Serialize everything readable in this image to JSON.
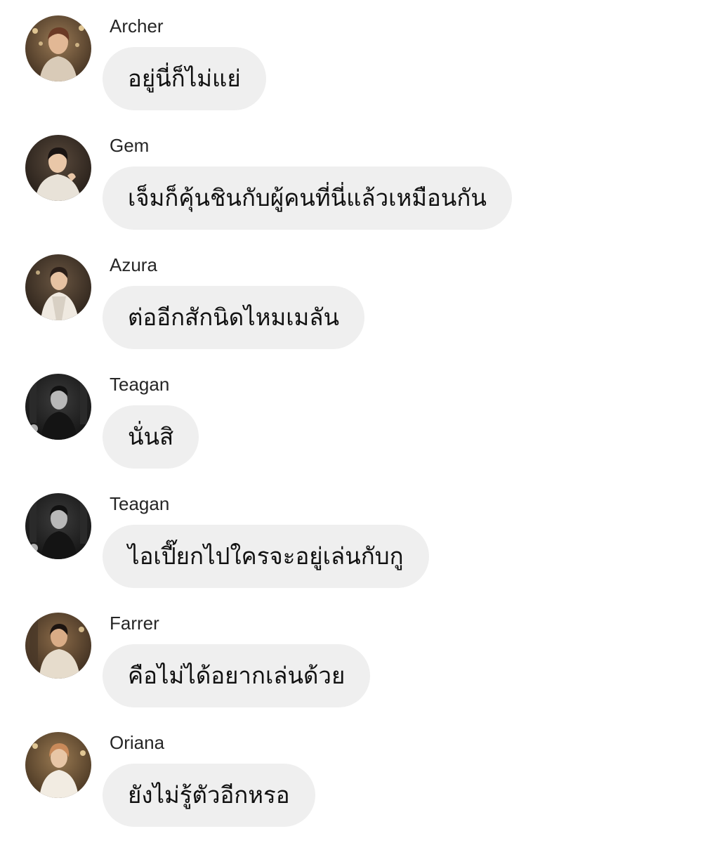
{
  "colors": {
    "background": "#ffffff",
    "bubble": "#efefef",
    "text": "#111111",
    "sender": "#262626"
  },
  "messages": [
    {
      "sender": "Archer",
      "text": "อยู่นี่ก็ไม่แย่",
      "avatar_icon": "avatar-photo-icon"
    },
    {
      "sender": "Gem",
      "text": "เจ็มก็คุ้นชินกับผู้คนที่นี่แล้วเหมือนกัน",
      "avatar_icon": "avatar-photo-icon"
    },
    {
      "sender": "Azura",
      "text": "ต่ออีกสักนิดไหมเมลัน",
      "avatar_icon": "avatar-photo-icon"
    },
    {
      "sender": "Teagan",
      "text": "นั่นสิ",
      "avatar_icon": "avatar-photo-icon"
    },
    {
      "sender": "Teagan",
      "text": "ไอเปี๊ยกไปใครจะอยู่เล่นกับกู",
      "avatar_icon": "avatar-photo-icon"
    },
    {
      "sender": "Farrer",
      "text": "คือไม่ได้อยากเล่นด้วย",
      "avatar_icon": "avatar-photo-icon"
    },
    {
      "sender": "Oriana",
      "text": "ยังไม่รู้ตัวอีกหรอ",
      "avatar_icon": "avatar-photo-icon"
    }
  ]
}
